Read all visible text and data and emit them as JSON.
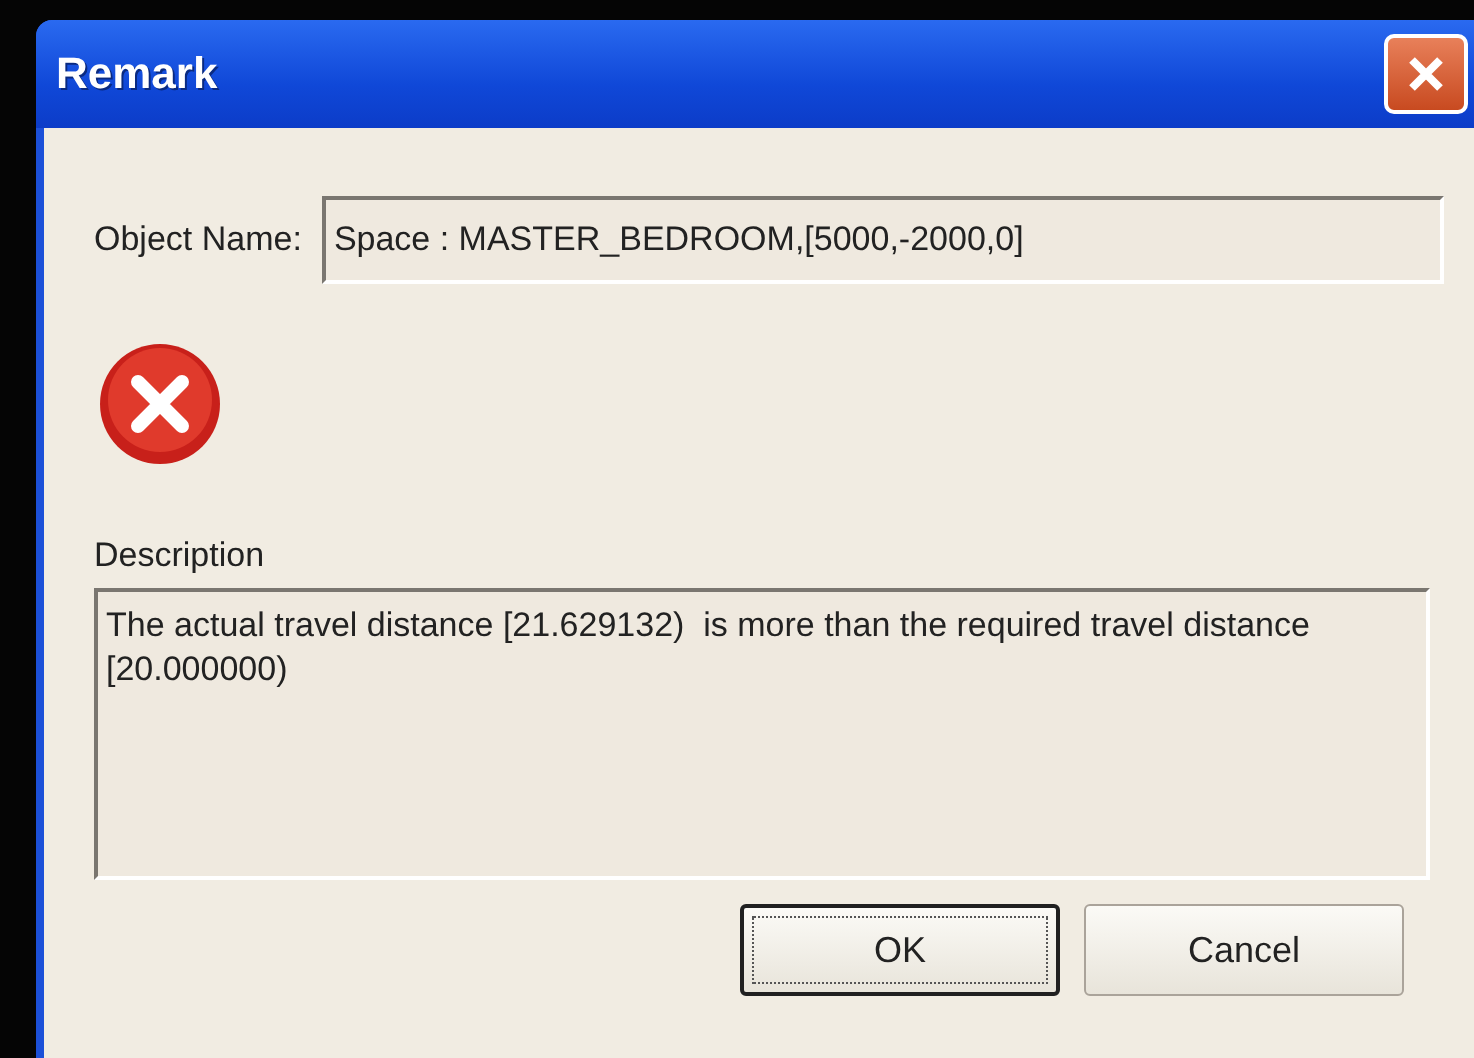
{
  "window": {
    "title": "Remark"
  },
  "object_name": {
    "label": "Object Name:",
    "value": "Space : MASTER_BEDROOM,[5000,-2000,0]"
  },
  "description": {
    "label": "Description",
    "value": "The actual travel distance [21.629132)  is more than the required travel distance [20.000000)"
  },
  "buttons": [
    {
      "label": "OK",
      "default": true
    },
    {
      "label": "Cancel",
      "default": false
    }
  ]
}
